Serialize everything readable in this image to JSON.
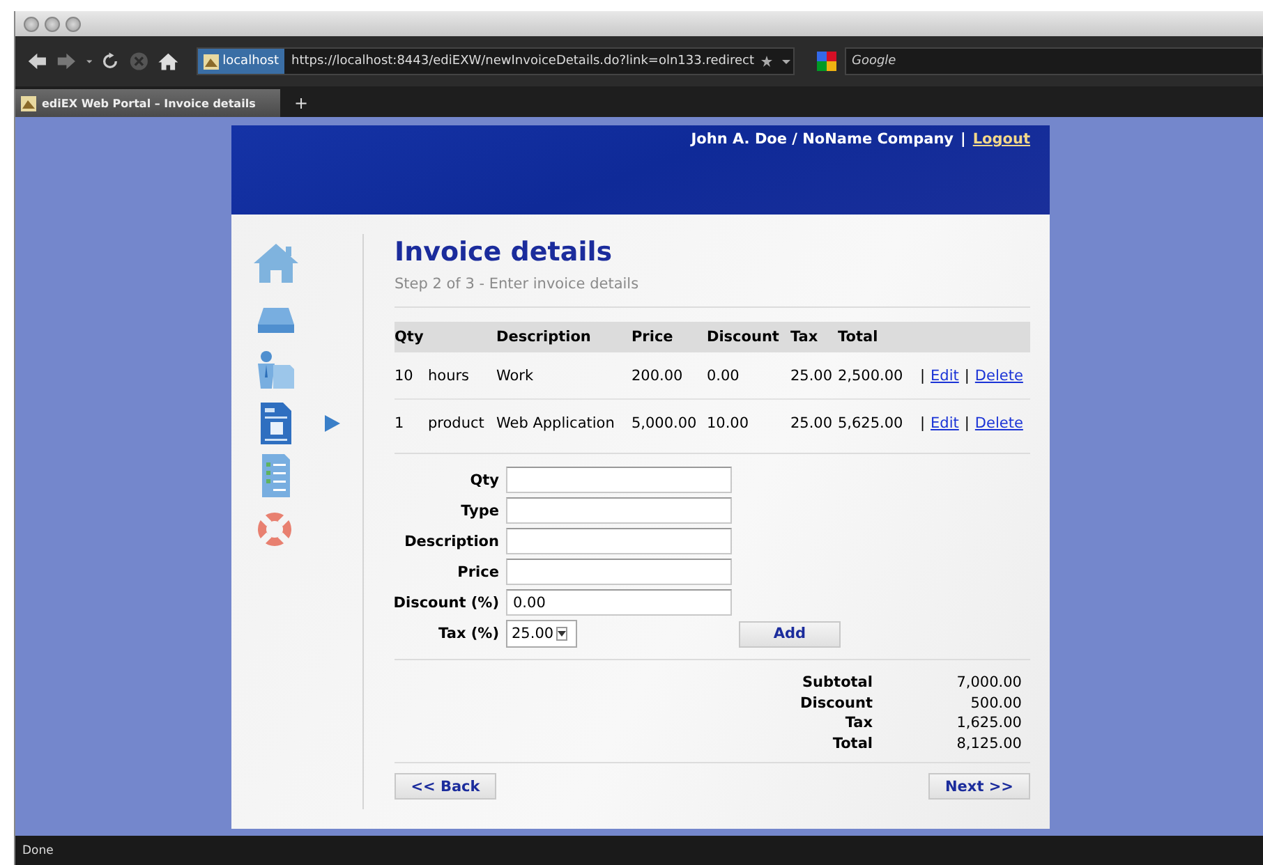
{
  "browser": {
    "url_badge": "localhost",
    "url": "https://localhost:8443/ediEXW/newInvoiceDetails.do?link=oln133.redirect",
    "search_placeholder": "Google",
    "tabs": [
      {
        "title": "ediEX Web Portal – Invoice details",
        "selected": true
      }
    ],
    "new_tab": "+",
    "status": "Done"
  },
  "header": {
    "user": "John A. Doe / NoName Company",
    "separator": "|",
    "logout": "Logout"
  },
  "sidebar": {
    "items": [
      {
        "kind": "home",
        "selected": false
      },
      {
        "kind": "tray",
        "selected": false
      },
      {
        "kind": "person",
        "selected": false
      },
      {
        "kind": "invoice",
        "selected": true
      },
      {
        "kind": "checklist",
        "selected": false
      },
      {
        "kind": "lifebuoy",
        "selected": false
      }
    ]
  },
  "page": {
    "title": "Invoice details",
    "subtitle": "Step 2 of 3 - Enter invoice details"
  },
  "table": {
    "columns": [
      "Qty",
      "Description",
      "Price",
      "Discount",
      "Tax",
      "Total"
    ],
    "link_separator": "|",
    "rows": [
      {
        "qty": "10",
        "unit": "hours",
        "description": "Work",
        "price": "200.00",
        "discount": "0.00",
        "tax": "25.00",
        "total": "2,500.00",
        "links": [
          "Edit",
          "Delete"
        ]
      },
      {
        "qty": "1",
        "unit": "product",
        "description": "Web Application",
        "price": "5,000.00",
        "discount": "10.00",
        "tax": "25.00",
        "total": "5,625.00",
        "links": [
          "Edit",
          "Delete"
        ]
      }
    ]
  },
  "form": {
    "fields": [
      {
        "label": "Qty",
        "kind": "text"
      },
      {
        "label": "Type",
        "kind": "text"
      },
      {
        "label": "Description",
        "kind": "text"
      },
      {
        "label": "Price",
        "kind": "text"
      },
      {
        "label": "Discount (%)",
        "kind": "text",
        "value": "0.00"
      },
      {
        "label": "Tax (%)",
        "kind": "select",
        "value": "25.00"
      }
    ],
    "add_button": "Add"
  },
  "totals": [
    {
      "label": "Subtotal",
      "value": "7,000.00"
    },
    {
      "label": "Discount",
      "value": "500.00"
    },
    {
      "label": "Tax",
      "value": "1,625.00"
    },
    {
      "label": "Total",
      "value": "8,125.00"
    }
  ],
  "buttons": {
    "back": "<< Back",
    "next": "Next >>"
  }
}
